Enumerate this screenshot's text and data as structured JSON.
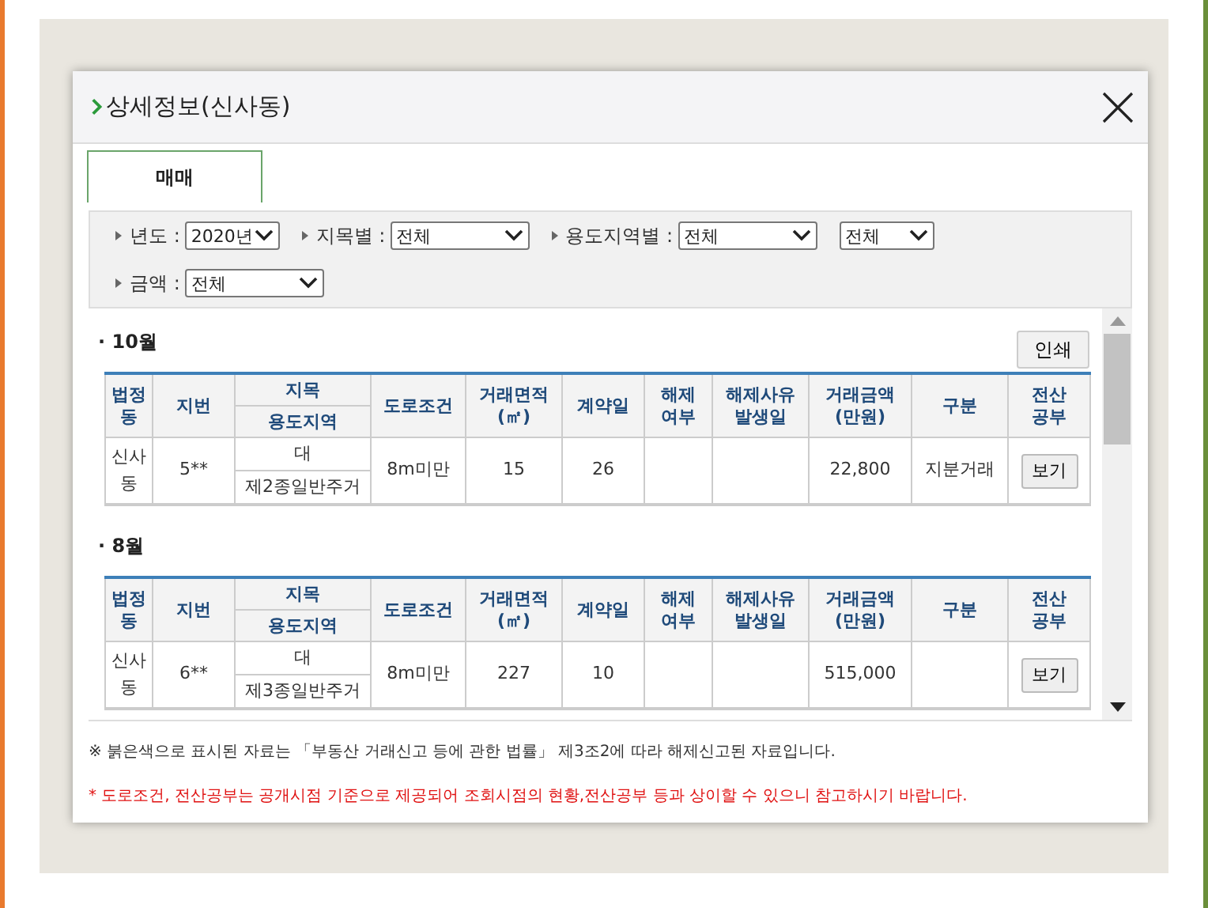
{
  "window": {
    "title": "상세정보(신사동)"
  },
  "tabs": [
    {
      "label": "매매",
      "selected": true
    }
  ],
  "filters": [
    {
      "label": "년도 :",
      "value": "2020년",
      "kind": "short"
    },
    {
      "label": "지목별 :",
      "value": "전체",
      "kind": "wide"
    },
    {
      "label": "용도지역별 :",
      "value": "전체",
      "kind": "wide"
    },
    {
      "value": "전체",
      "kind": "short"
    },
    {
      "label": "금액 :",
      "value": "전체",
      "kind": "wide"
    }
  ],
  "print_button": "인쇄",
  "sections": [
    {
      "month": "· 10월",
      "headers": [
        "법정동",
        "지번",
        "지목",
        "용도지역",
        "도로조건",
        "거래면적\n(㎡)",
        "계약일",
        "해제\n여부",
        "해제사유\n발생일",
        "거래금액\n(만원)",
        "구분",
        "전산\n공부"
      ],
      "rows": [
        {
          "dong": "신사\n동",
          "jibun": "5**",
          "jimok": "대",
          "zone": "제2종일반주거",
          "road": "8m미만",
          "area": "15",
          "day": "26",
          "amount": "22,800",
          "type": "지분거래",
          "doc_button": "보기"
        }
      ]
    },
    {
      "month": "· 8월",
      "headers": [
        "법정동",
        "지번",
        "지목",
        "용도지역",
        "도로조건",
        "거래면적\n(㎡)",
        "계약일",
        "해제\n여부",
        "해제사유\n발생일",
        "거래금액\n(만원)",
        "구분",
        "전산\n공부"
      ],
      "rows": [
        {
          "dong": "신사\n동",
          "jibun": "6**",
          "jimok": "대",
          "zone": "제3종일반주거",
          "road": "8m미만",
          "area": "227",
          "day": "10",
          "amount": "515,000",
          "doc_button": "보기"
        }
      ]
    }
  ],
  "notes": [
    {
      "text": "※ 붉은색으로 표시된 자료는 「부동산 거래신고 등에 관한 법률」 제3조2에 따라 해제신고된 자료입니다.",
      "kind": "info"
    },
    {
      "text": "* 도로조건, 전산공부는 공개시점 기준으로 제공되어 조회시점의 현황,전산공부 등과 상이할 수 있으니 참고하시기 바랍니다.",
      "kind": "warning"
    }
  ]
}
